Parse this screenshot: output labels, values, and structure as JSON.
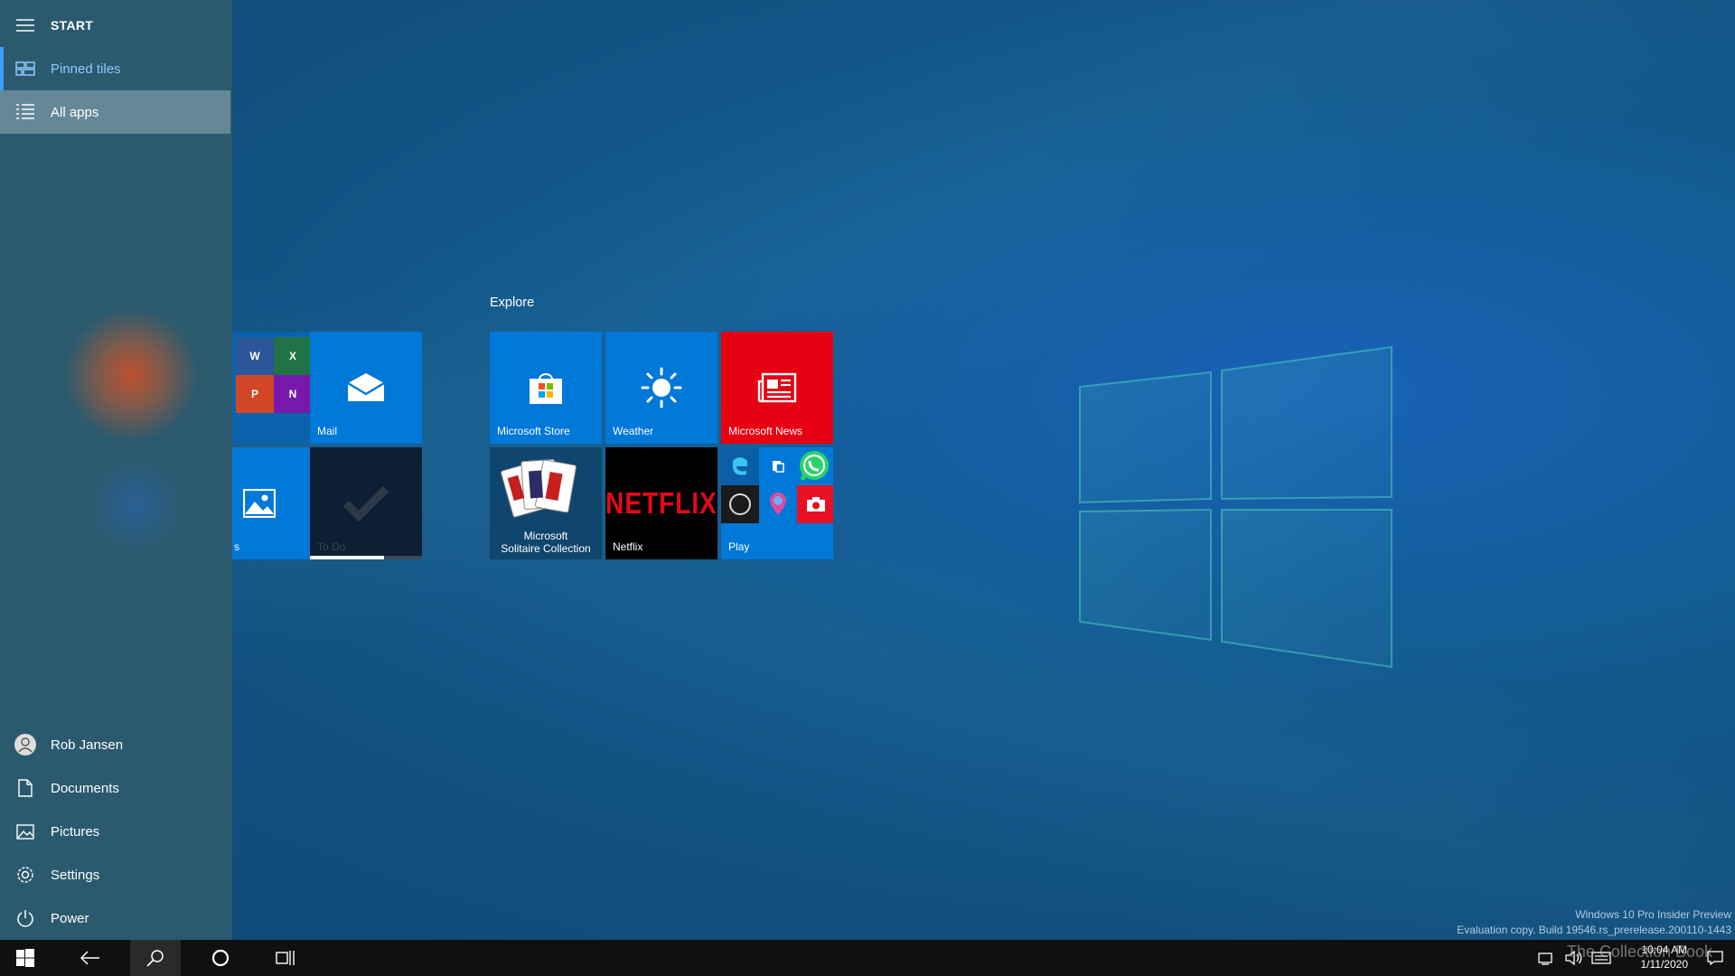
{
  "start_menu": {
    "header": "START",
    "pinned_label": "Pinned tiles",
    "allapps_label": "All apps",
    "user_name": "Rob Jansen",
    "documents_label": "Documents",
    "pictures_label": "Pictures",
    "settings_label": "Settings",
    "power_label": "Power"
  },
  "tiles": {
    "group_title": "Explore",
    "mail": "Mail",
    "todo": "To Do",
    "photos_partial": "s",
    "store": "Microsoft Store",
    "weather": "Weather",
    "news": "Microsoft News",
    "solitaire_line1": "Microsoft",
    "solitaire_line2": "Solitaire Collection",
    "netflix": "Netflix",
    "netflix_logo": "NETFLIX",
    "play": "Play",
    "office_word": "W",
    "office_excel": "X",
    "office_ppt": "P",
    "office_onenote": "N"
  },
  "watermark": {
    "line1": "Windows 10 Pro Insider Preview",
    "line2": "Evaluation copy. Build 19546.rs_prerelease.200110-1443"
  },
  "overlay_text": "The Collection Book",
  "taskbar": {
    "time": "10:04 AM",
    "date": "1/11/2020"
  },
  "colors": {
    "accent": "#0078d7",
    "news_red": "#e81123",
    "nav_bg": "#2b5a6e",
    "taskbar_bg": "#101010"
  }
}
